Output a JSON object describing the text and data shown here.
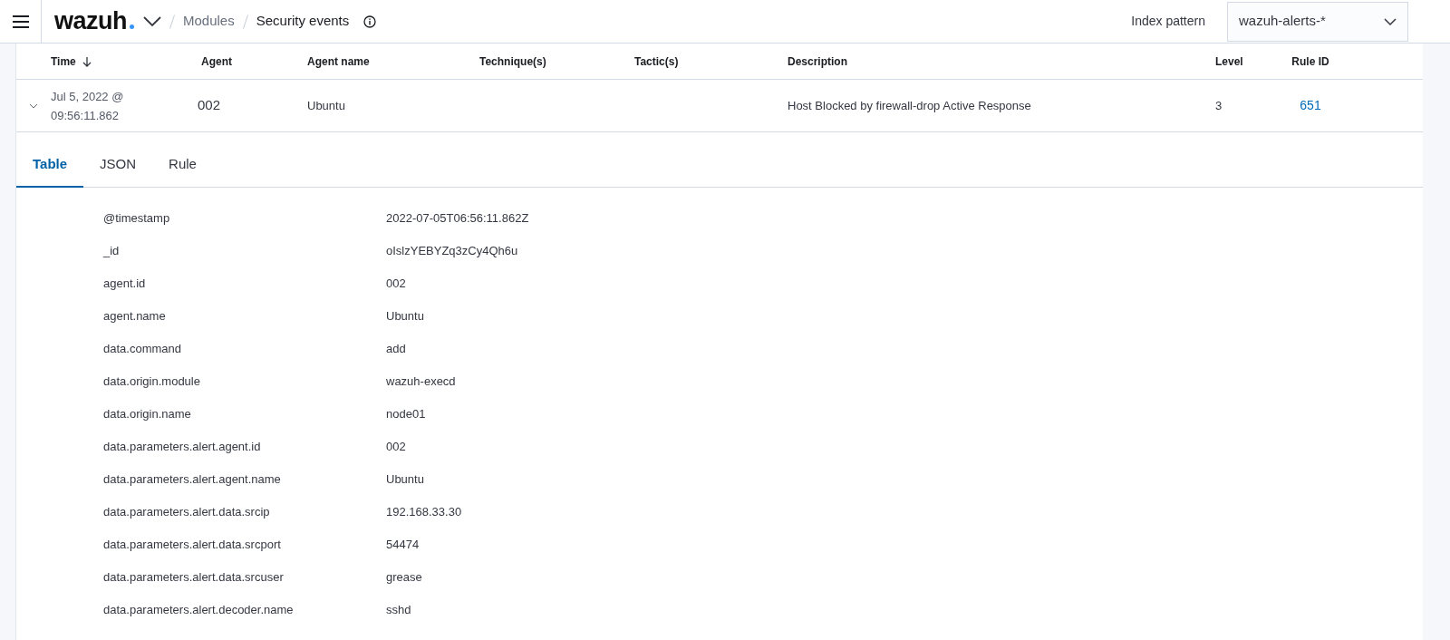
{
  "header": {
    "logo": "wazuh",
    "breadcrumbs": [
      {
        "label": "Modules",
        "current": false
      },
      {
        "label": "Security events",
        "current": true
      }
    ],
    "index_pattern_label": "Index pattern",
    "index_pattern": "wazuh-alerts-*"
  },
  "table": {
    "columns": [
      {
        "label": "Time",
        "sorted": true
      },
      {
        "label": "Agent",
        "sorted": false
      },
      {
        "label": "Agent name",
        "sorted": false
      },
      {
        "label": "Technique(s)",
        "sorted": false
      },
      {
        "label": "Tactic(s)",
        "sorted": false
      },
      {
        "label": "Description",
        "sorted": false
      },
      {
        "label": "Level",
        "sorted": false
      },
      {
        "label": "Rule ID",
        "sorted": false
      }
    ],
    "rows": [
      {
        "expanded": true,
        "time": "Jul 5, 2022 @ 09:56:11.862",
        "agent": "002",
        "agent_name": "Ubuntu",
        "techniques": "",
        "tactics": "",
        "description": "Host Blocked by firewall-drop Active Response",
        "level": "3",
        "rule_id": "651"
      }
    ]
  },
  "details": {
    "tabs": [
      {
        "label": "Table",
        "selected": true
      },
      {
        "label": "JSON",
        "selected": false
      },
      {
        "label": "Rule",
        "selected": false
      }
    ],
    "fields": [
      {
        "key": "@timestamp",
        "value": "2022-07-05T06:56:11.862Z"
      },
      {
        "key": "_id",
        "value": "oIslzYEBYZq3zCy4Qh6u"
      },
      {
        "key": "agent.id",
        "value": "002"
      },
      {
        "key": "agent.name",
        "value": "Ubuntu"
      },
      {
        "key": "data.command",
        "value": "add"
      },
      {
        "key": "data.origin.module",
        "value": "wazuh-execd"
      },
      {
        "key": "data.origin.name",
        "value": "node01"
      },
      {
        "key": "data.parameters.alert.agent.id",
        "value": "002"
      },
      {
        "key": "data.parameters.alert.agent.name",
        "value": "Ubuntu"
      },
      {
        "key": "data.parameters.alert.data.srcip",
        "value": "192.168.33.30"
      },
      {
        "key": "data.parameters.alert.data.srcport",
        "value": "54474"
      },
      {
        "key": "data.parameters.alert.data.srcuser",
        "value": "grease"
      },
      {
        "key": "data.parameters.alert.decoder.name",
        "value": "sshd"
      }
    ]
  }
}
